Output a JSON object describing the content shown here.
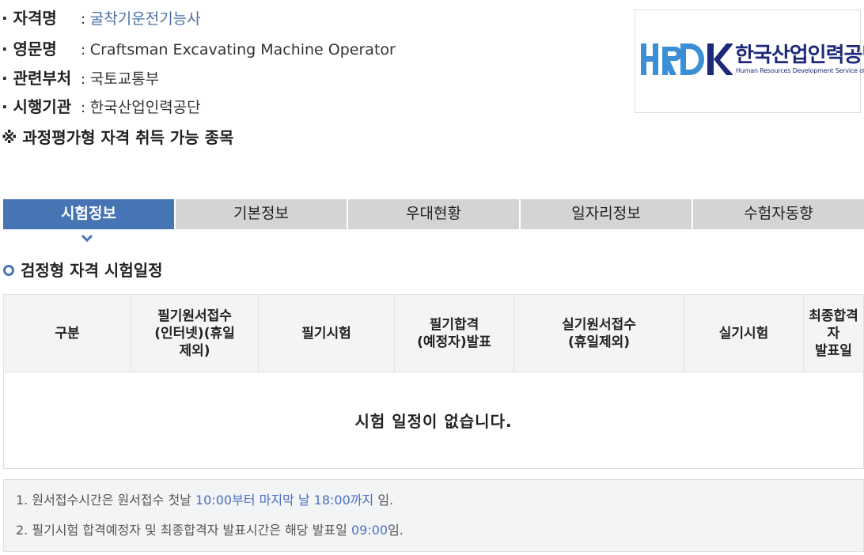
{
  "info": {
    "qualification_label": "· 자격명",
    "qualification_value": "굴착기운전기능사",
    "english_label": "· 영문명",
    "english_value": "Craftsman Excavating Machine Operator",
    "ministry_label": "· 관련부처",
    "ministry_value": "국토교통부",
    "agency_label": "· 시행기관",
    "agency_value": "한국산업인력공단",
    "colon": ": ",
    "note": "※ 과정평가형 자격 취득 가능 종목"
  },
  "logo": {
    "mark": "HRDK",
    "korean": "한국산업인력공단",
    "english": "Human Resources Development Service of Korea"
  },
  "tabs": [
    {
      "label": "시험정보",
      "active": true
    },
    {
      "label": "기본정보",
      "active": false
    },
    {
      "label": "우대현황",
      "active": false
    },
    {
      "label": "일자리정보",
      "active": false
    },
    {
      "label": "수험자동향",
      "active": false
    }
  ],
  "section_title": "검정형 자격 시험일정",
  "table": {
    "headers": [
      "구분",
      "필기원서접수\n(인터넷)(휴일\n제외)",
      "필기시험",
      "필기합격\n(예정자)발표",
      "실기원서접수\n(휴일제외)",
      "실기시험",
      "최종합격자\n발표일"
    ],
    "empty_message": "시험 일정이 없습니다."
  },
  "notes": {
    "line1_prefix": "1. 원서접수시간은 원서접수 첫날 ",
    "line1_highlight": "10:00부터 마지막 날 18:00까지",
    "line1_suffix": " 임.",
    "line2_prefix": "2. 필기시험 합격예정자 및 최종합격자 발표시간은 해당 발표일 ",
    "line2_highlight": "09:00",
    "line2_suffix": "임."
  },
  "colors": {
    "accent": "#4674b5",
    "link": "#4a6fa5",
    "logo_navy": "#1d2a7a",
    "logo_blue": "#3a8fd6"
  }
}
